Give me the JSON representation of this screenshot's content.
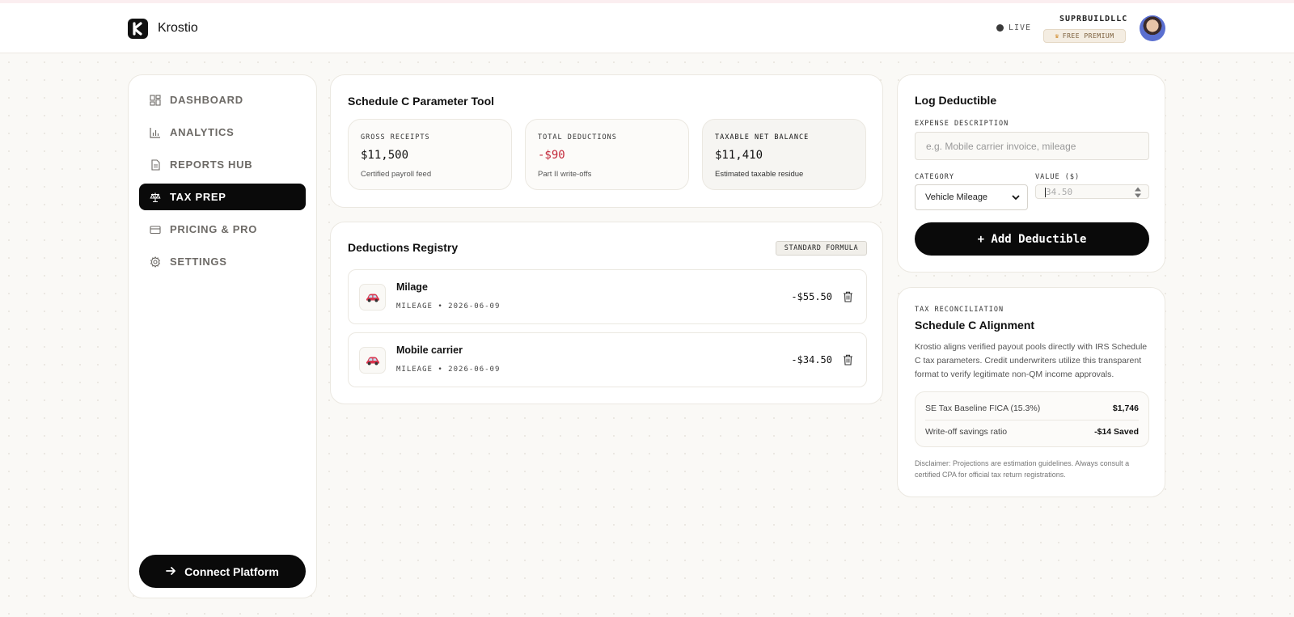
{
  "app": {
    "brand": "Krostio",
    "status": "LIVE",
    "username": "SUPRBUILDLLC",
    "plan_badge": "FREE PREMIUM"
  },
  "sidebar": {
    "items": [
      {
        "label": "DASHBOARD",
        "icon": "dashboard-icon"
      },
      {
        "label": "ANALYTICS",
        "icon": "bar-chart-icon"
      },
      {
        "label": "REPORTS HUB",
        "icon": "document-icon"
      },
      {
        "label": "TAX PREP",
        "icon": "scale-icon",
        "active": true
      },
      {
        "label": "PRICING & PRO",
        "icon": "credit-card-icon"
      },
      {
        "label": "SETTINGS",
        "icon": "gear-icon"
      }
    ],
    "connect_label": "Connect Platform"
  },
  "schedule": {
    "title": "Schedule C Parameter Tool",
    "stats": [
      {
        "label": "GROSS RECEIPTS",
        "value": "$11,500",
        "sub": "Certified payroll feed"
      },
      {
        "label": "TOTAL DEDUCTIONS",
        "value": "-$90",
        "sub": "Part II write-offs"
      },
      {
        "label": "TAXABLE NET BALANCE",
        "value": "$11,410",
        "sub": "Estimated taxable residue"
      }
    ]
  },
  "registry": {
    "title": "Deductions Registry",
    "badge": "STANDARD FORMULA",
    "rows": [
      {
        "title": "Milage",
        "meta": "MILEAGE • 2026-06-09",
        "amount": "-$55.50",
        "icon": "car-icon"
      },
      {
        "title": "Mobile carrier",
        "meta": "MILEAGE • 2026-06-09",
        "amount": "-$34.50",
        "icon": "car-icon"
      }
    ]
  },
  "log_form": {
    "title": "Log Deductible",
    "description_label": "EXPENSE DESCRIPTION",
    "description_placeholder": "e.g. Mobile carrier invoice, mileage",
    "category_label": "CATEGORY",
    "category_value": "Vehicle Mileage",
    "value_label": "VALUE ($)",
    "value_placeholder": "34.50",
    "submit_label": "+ Add Deductible"
  },
  "reconciliation": {
    "overline": "TAX RECONCILIATION",
    "title": "Schedule C Alignment",
    "body": "Krostio aligns verified payout pools directly with IRS Schedule C tax parameters. Credit underwriters utilize this transparent format to verify legitimate non-QM income approvals.",
    "rows": [
      {
        "label": "SE Tax Baseline FICA (15.3%)",
        "value": "$1,746"
      },
      {
        "label": "Write-off savings ratio",
        "value": "-$14 Saved"
      }
    ],
    "disclaimer": "Disclaimer: Projections are estimation guidelines. Always consult a certified CPA for official tax return registrations."
  },
  "colors": {
    "accent": "#0a0a0a",
    "negative": "#c3283a",
    "background": "#faf9f6"
  }
}
